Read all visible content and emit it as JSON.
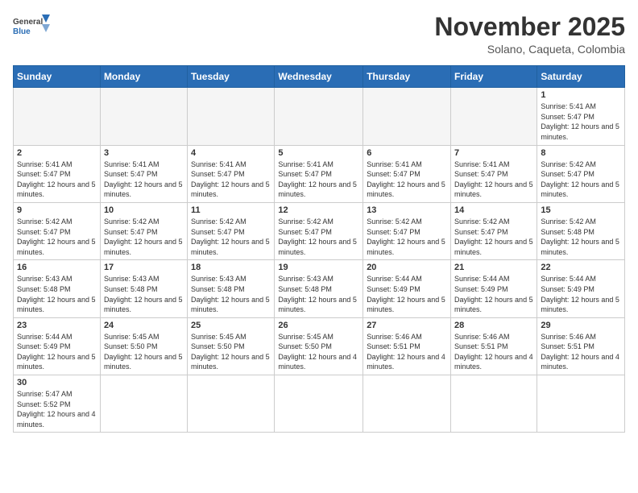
{
  "logo": {
    "text_general": "General",
    "text_blue": "Blue"
  },
  "header": {
    "title": "November 2025",
    "subtitle": "Solano, Caqueta, Colombia"
  },
  "weekdays": [
    "Sunday",
    "Monday",
    "Tuesday",
    "Wednesday",
    "Thursday",
    "Friday",
    "Saturday"
  ],
  "weeks": [
    [
      {
        "day": "",
        "info": ""
      },
      {
        "day": "",
        "info": ""
      },
      {
        "day": "",
        "info": ""
      },
      {
        "day": "",
        "info": ""
      },
      {
        "day": "",
        "info": ""
      },
      {
        "day": "",
        "info": ""
      },
      {
        "day": "1",
        "info": "Sunrise: 5:41 AM\nSunset: 5:47 PM\nDaylight: 12 hours and 5 minutes."
      }
    ],
    [
      {
        "day": "2",
        "info": "Sunrise: 5:41 AM\nSunset: 5:47 PM\nDaylight: 12 hours and 5 minutes."
      },
      {
        "day": "3",
        "info": "Sunrise: 5:41 AM\nSunset: 5:47 PM\nDaylight: 12 hours and 5 minutes."
      },
      {
        "day": "4",
        "info": "Sunrise: 5:41 AM\nSunset: 5:47 PM\nDaylight: 12 hours and 5 minutes."
      },
      {
        "day": "5",
        "info": "Sunrise: 5:41 AM\nSunset: 5:47 PM\nDaylight: 12 hours and 5 minutes."
      },
      {
        "day": "6",
        "info": "Sunrise: 5:41 AM\nSunset: 5:47 PM\nDaylight: 12 hours and 5 minutes."
      },
      {
        "day": "7",
        "info": "Sunrise: 5:41 AM\nSunset: 5:47 PM\nDaylight: 12 hours and 5 minutes."
      },
      {
        "day": "8",
        "info": "Sunrise: 5:42 AM\nSunset: 5:47 PM\nDaylight: 12 hours and 5 minutes."
      }
    ],
    [
      {
        "day": "9",
        "info": "Sunrise: 5:42 AM\nSunset: 5:47 PM\nDaylight: 12 hours and 5 minutes."
      },
      {
        "day": "10",
        "info": "Sunrise: 5:42 AM\nSunset: 5:47 PM\nDaylight: 12 hours and 5 minutes."
      },
      {
        "day": "11",
        "info": "Sunrise: 5:42 AM\nSunset: 5:47 PM\nDaylight: 12 hours and 5 minutes."
      },
      {
        "day": "12",
        "info": "Sunrise: 5:42 AM\nSunset: 5:47 PM\nDaylight: 12 hours and 5 minutes."
      },
      {
        "day": "13",
        "info": "Sunrise: 5:42 AM\nSunset: 5:47 PM\nDaylight: 12 hours and 5 minutes."
      },
      {
        "day": "14",
        "info": "Sunrise: 5:42 AM\nSunset: 5:47 PM\nDaylight: 12 hours and 5 minutes."
      },
      {
        "day": "15",
        "info": "Sunrise: 5:42 AM\nSunset: 5:48 PM\nDaylight: 12 hours and 5 minutes."
      }
    ],
    [
      {
        "day": "16",
        "info": "Sunrise: 5:43 AM\nSunset: 5:48 PM\nDaylight: 12 hours and 5 minutes."
      },
      {
        "day": "17",
        "info": "Sunrise: 5:43 AM\nSunset: 5:48 PM\nDaylight: 12 hours and 5 minutes."
      },
      {
        "day": "18",
        "info": "Sunrise: 5:43 AM\nSunset: 5:48 PM\nDaylight: 12 hours and 5 minutes."
      },
      {
        "day": "19",
        "info": "Sunrise: 5:43 AM\nSunset: 5:48 PM\nDaylight: 12 hours and 5 minutes."
      },
      {
        "day": "20",
        "info": "Sunrise: 5:44 AM\nSunset: 5:49 PM\nDaylight: 12 hours and 5 minutes."
      },
      {
        "day": "21",
        "info": "Sunrise: 5:44 AM\nSunset: 5:49 PM\nDaylight: 12 hours and 5 minutes."
      },
      {
        "day": "22",
        "info": "Sunrise: 5:44 AM\nSunset: 5:49 PM\nDaylight: 12 hours and 5 minutes."
      }
    ],
    [
      {
        "day": "23",
        "info": "Sunrise: 5:44 AM\nSunset: 5:49 PM\nDaylight: 12 hours and 5 minutes."
      },
      {
        "day": "24",
        "info": "Sunrise: 5:45 AM\nSunset: 5:50 PM\nDaylight: 12 hours and 5 minutes."
      },
      {
        "day": "25",
        "info": "Sunrise: 5:45 AM\nSunset: 5:50 PM\nDaylight: 12 hours and 5 minutes."
      },
      {
        "day": "26",
        "info": "Sunrise: 5:45 AM\nSunset: 5:50 PM\nDaylight: 12 hours and 4 minutes."
      },
      {
        "day": "27",
        "info": "Sunrise: 5:46 AM\nSunset: 5:51 PM\nDaylight: 12 hours and 4 minutes."
      },
      {
        "day": "28",
        "info": "Sunrise: 5:46 AM\nSunset: 5:51 PM\nDaylight: 12 hours and 4 minutes."
      },
      {
        "day": "29",
        "info": "Sunrise: 5:46 AM\nSunset: 5:51 PM\nDaylight: 12 hours and 4 minutes."
      }
    ],
    [
      {
        "day": "30",
        "info": "Sunrise: 5:47 AM\nSunset: 5:52 PM\nDaylight: 12 hours and 4 minutes."
      },
      {
        "day": "",
        "info": ""
      },
      {
        "day": "",
        "info": ""
      },
      {
        "day": "",
        "info": ""
      },
      {
        "day": "",
        "info": ""
      },
      {
        "day": "",
        "info": ""
      },
      {
        "day": "",
        "info": ""
      }
    ]
  ]
}
